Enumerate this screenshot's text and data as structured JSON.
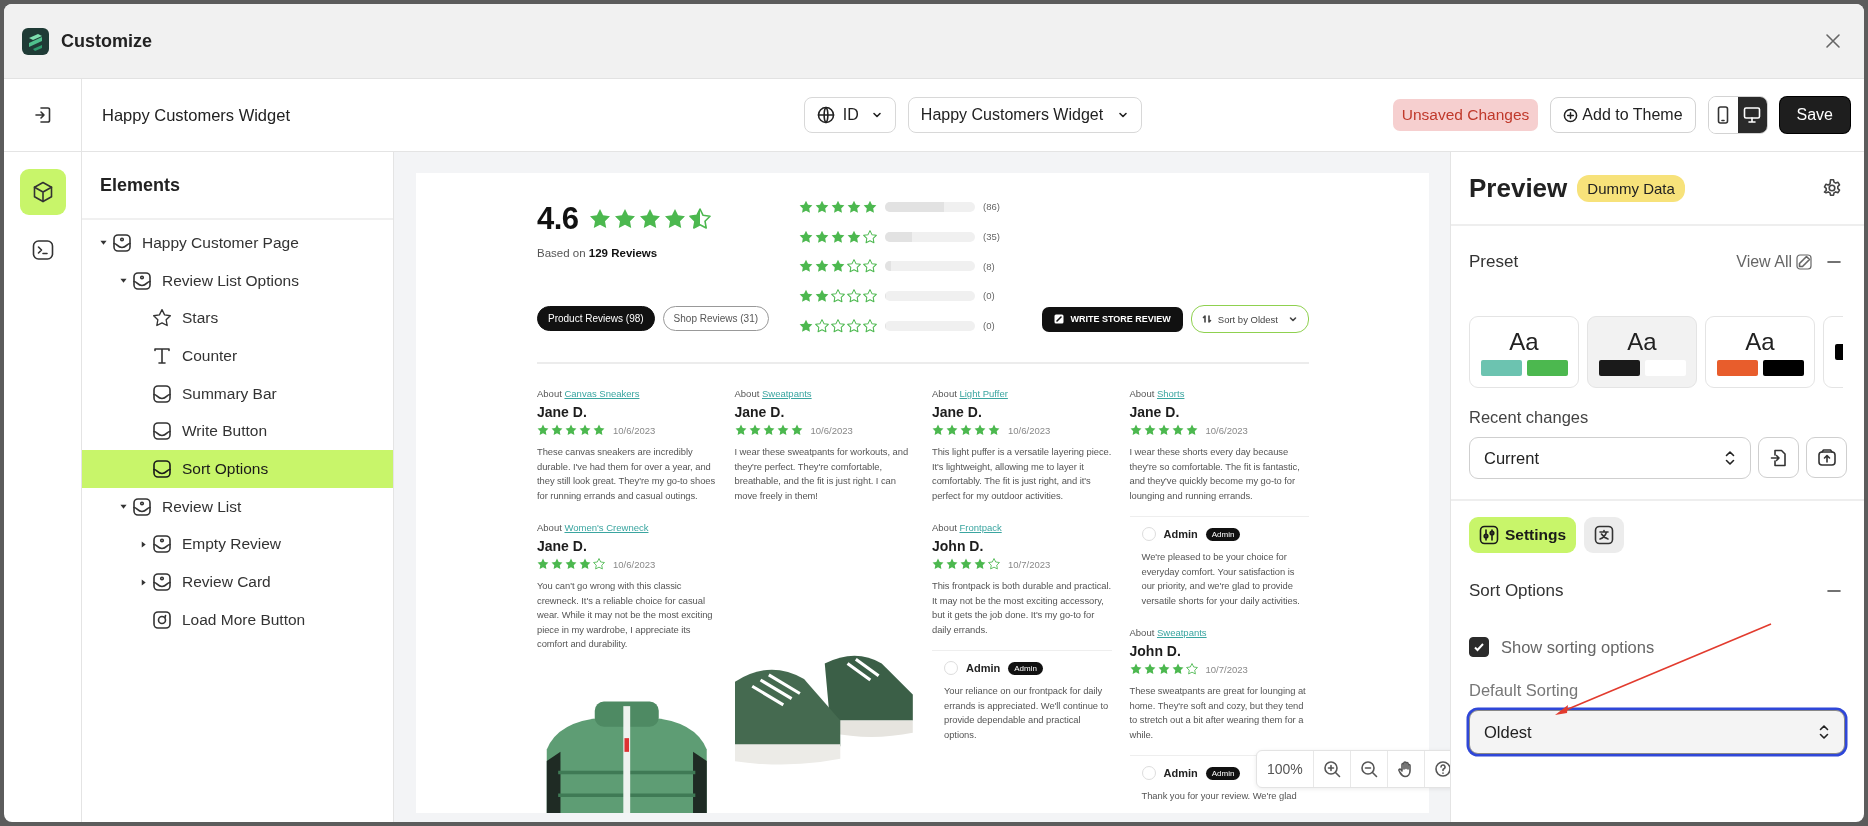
{
  "window": {
    "title": "Customize"
  },
  "toolbar": {
    "title": "Happy Customers Widget",
    "language": "ID",
    "template": "Happy Customers Widget",
    "status": "Unsaved Changes",
    "add_button": "Add to Theme",
    "devices": [
      {
        "kind": "mobile",
        "selected": false
      },
      {
        "kind": "desktop",
        "selected": true
      }
    ],
    "save_button": "Save"
  },
  "rail": [
    {
      "kind": "elements",
      "selected": true
    },
    {
      "kind": "code",
      "selected": false
    }
  ],
  "elements": {
    "title": "Elements",
    "tree": [
      {
        "label": "Happy Customer Page",
        "kind": "section",
        "expanded": true,
        "selected": false,
        "children": [
          {
            "label": "Review List Options",
            "kind": "section",
            "expanded": true,
            "selected": false,
            "children": [
              {
                "label": "Stars",
                "kind": "star",
                "selected": false
              },
              {
                "label": "Counter",
                "kind": "text",
                "selected": false
              },
              {
                "label": "Summary Bar",
                "kind": "block",
                "selected": false
              },
              {
                "label": "Write Button",
                "kind": "block",
                "selected": false
              },
              {
                "label": "Sort Options",
                "kind": "block",
                "selected": true
              }
            ]
          },
          {
            "label": "Review List",
            "kind": "section",
            "expanded": true,
            "selected": false,
            "children": [
              {
                "label": "Empty Review",
                "kind": "section",
                "expanded": false,
                "selected": false
              },
              {
                "label": "Review Card",
                "kind": "section",
                "expanded": false,
                "selected": false
              },
              {
                "label": "Load More Button",
                "kind": "load",
                "selected": false
              }
            ]
          }
        ]
      }
    ]
  },
  "preview": {
    "rating": "4.6",
    "stars": 4.5,
    "based_on": "Based on **129 Reviews**",
    "distribution": [
      {
        "stars": 5,
        "level": 0.66,
        "count": "(86)"
      },
      {
        "stars": 4,
        "level": 0.3,
        "count": "(35)"
      },
      {
        "stars": 3,
        "level": 0.07,
        "count": "(8)"
      },
      {
        "stars": 2,
        "level": 0,
        "count": "(0)"
      },
      {
        "stars": 1,
        "level": 0,
        "count": "(0)"
      }
    ],
    "tabs": [
      {
        "label": "Product Reviews (98)",
        "selected": true
      },
      {
        "label": "Shop Reviews (31)",
        "selected": false
      }
    ],
    "write_button": "WRITE STORE REVIEW",
    "sort_button": "Sort by Oldest",
    "columns": [
      [
        {
          "kind": "review",
          "about": "About",
          "product": "Canvas Sneakers",
          "author": "Jane D.",
          "stars": 5,
          "date": "10/6/2023",
          "text": "These canvas sneakers are incredibly durable. I've had them for over a year, and they still look great. They're my go-to shoes for running errands and casual outings."
        },
        {
          "kind": "review",
          "about": "About",
          "product": "Women's Crewneck",
          "author": "Jane D.",
          "stars": 4,
          "date": "10/6/2023",
          "text": "You can't go wrong with this classic crewneck. It's a reliable choice for casual wear. While it may not be the most exciting piece in my wardrobe, I appreciate its comfort and durability."
        },
        {
          "kind": "picture"
        }
      ],
      [
        {
          "kind": "review",
          "about": "About",
          "product": "Sweatpants",
          "author": "Jane D.",
          "stars": 5,
          "date": "10/6/2023",
          "text": "I wear these sweatpants for workouts, and they're perfect. They're comfortable, breathable, and the fit is just right. I can move freely in them!"
        },
        {
          "kind": "picture"
        }
      ],
      [
        {
          "kind": "review",
          "about": "About",
          "product": "Light Puffer",
          "author": "Jane D.",
          "stars": 5,
          "date": "10/6/2023",
          "text": "This light puffer is a versatile layering piece. It's lightweight, allowing me to layer it comfortably. The fit is just right, and it's perfect for my outdoor activities."
        },
        {
          "kind": "review",
          "about": "About",
          "product": "Frontpack",
          "author": "John D.",
          "stars": 4,
          "date": "10/7/2023",
          "text": "This frontpack is both durable and practical. It may not be the most exciting accessory, but it gets the job done. It's my go-to for daily errands."
        },
        {
          "kind": "reply",
          "author": "Admin",
          "badge": "Admin",
          "text": "Your reliance on our frontpack for daily errands is appreciated. We'll continue to provide dependable and practical options."
        }
      ],
      [
        {
          "kind": "review",
          "about": "About",
          "product": "Shorts",
          "author": "Jane D.",
          "stars": 5,
          "date": "10/6/2023",
          "text": "I wear these shorts every day because they're so comfortable. The fit is fantastic, and they've quickly become my go-to for lounging and running errands."
        },
        {
          "kind": "reply",
          "author": "Admin",
          "badge": "Admin",
          "text": "We're pleased to be your choice for everyday comfort. Your satisfaction is our priority, and we're glad to provide versatile shorts for your daily activities."
        },
        {
          "kind": "review",
          "about": "About",
          "product": "Sweatpants",
          "author": "John D.",
          "stars": 4,
          "date": "10/7/2023",
          "text": "These sweatpants are great for lounging at home. They're soft and cozy, but they tend to stretch out a bit after wearing them for a while."
        },
        {
          "kind": "reply",
          "author": "Admin",
          "badge": "Admin",
          "text": "Thank you for your review. We're glad"
        }
      ]
    ]
  },
  "zoom": {
    "level": "100%"
  },
  "panel": {
    "title": "Preview",
    "badge": "Dummy Data",
    "preset_title": "Preset",
    "view_all": "View All",
    "presets": [
      {
        "sample": "Aa",
        "swatches": [
          {
            "color": "#6cc3b0"
          },
          {
            "color": "#4cb84f"
          }
        ],
        "selected": false
      },
      {
        "sample": "Aa",
        "swatches": [
          {
            "color": "#1a1a1a"
          },
          {
            "color": "#ffffff"
          }
        ],
        "selected": true
      },
      {
        "sample": "Aa",
        "swatches": [
          {
            "color": "#e85d2c"
          },
          {
            "color": "#000000"
          }
        ],
        "selected": false
      },
      {
        "swatches": [
          {
            "color": "#000000"
          }
        ],
        "selected": false
      }
    ],
    "recent_label": "Recent changes",
    "recent_value": "Current",
    "tabs": [
      {
        "kind": "settings",
        "label": "Settings",
        "selected": true
      },
      {
        "kind": "translate",
        "selected": false
      }
    ],
    "section_title": "Sort Options",
    "show_sorting": {
      "label": "Show sorting options",
      "checked": true
    },
    "default_label": "Default Sorting",
    "default_value": "Oldest",
    "focused": true
  }
}
